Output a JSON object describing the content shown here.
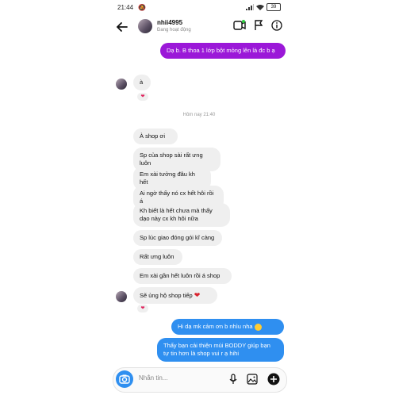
{
  "status_bar": {
    "time": "21:44",
    "battery": "39"
  },
  "header": {
    "username": "nhii4995",
    "status": "Đang hoạt động"
  },
  "messages": {
    "m1": "Dạ b. B thoa 1 lớp bột mỏng lên là đc b ạ",
    "m2": "à",
    "timestamp": "Hôm nay 21:40",
    "m3": "À shop ơi",
    "m4": "Sp của shop sài rất ưng luôn",
    "m5": "Em xài tưởng đâu kh hết",
    "m6": "Ai ngờ thấy nó cx hết hôi rồi á",
    "m7": "Kh biết là hết chưa mà thấy dạo này cx kh hôi nữa",
    "m8": "Sp lúc giao đóng gói kĩ càng",
    "m9": "Rất ưng luôn",
    "m10": "Em xài gần hết luôn rồi á shop",
    "m11": "Sẽ ủng hộ shop tiếp",
    "m12": "Hi dạ mk cảm ơn b nhìu nha",
    "m13": "Thấy bạn cải thiện mùi BODDY giúp bạn tự tin hơn là shop vui r ạ hihi"
  },
  "composer": {
    "placeholder": "Nhắn tin..."
  },
  "colors": {
    "outgoing_purple": "#9b18d8",
    "outgoing_blue": "#2f8ff0",
    "incoming": "#efefef",
    "heart": "#e0245e"
  }
}
